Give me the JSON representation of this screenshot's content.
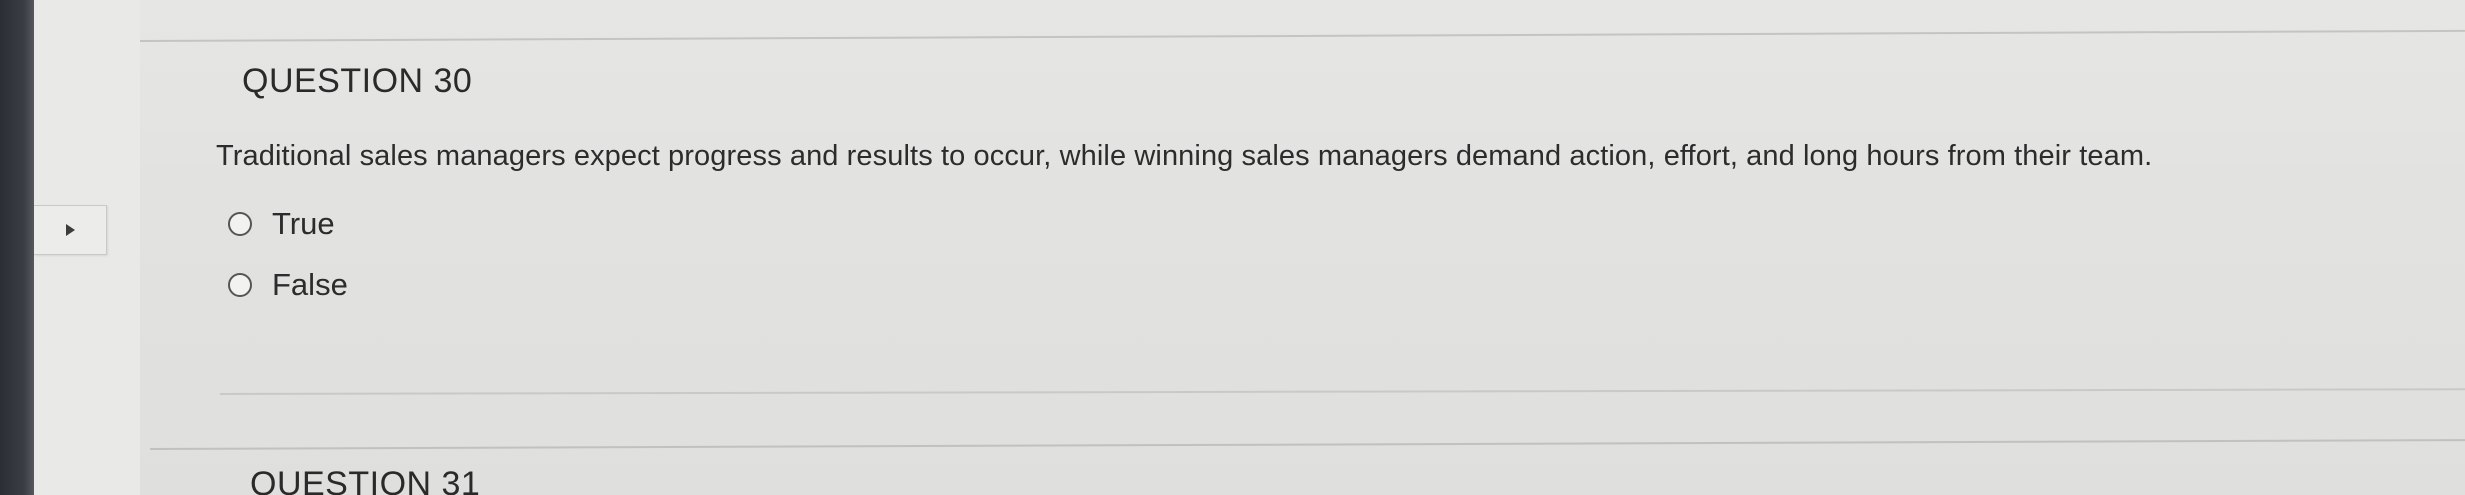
{
  "question": {
    "title": "QUESTION 30",
    "text": "Traditional sales managers expect progress and results to occur, while winning sales managers demand action, effort, and long hours from their team.",
    "options": [
      {
        "label": "True",
        "selected": false
      },
      {
        "label": "False",
        "selected": false
      }
    ]
  },
  "next_question": {
    "title": "QUESTION 31"
  },
  "sidebar_toggle": {
    "icon": "triangle-right-icon"
  }
}
